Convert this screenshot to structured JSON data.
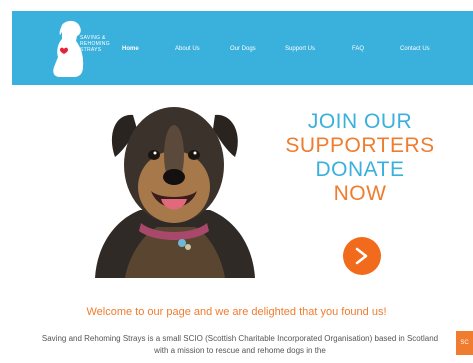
{
  "header": {
    "logo_lines": [
      "Saving &",
      "Rehoming",
      "Strays"
    ],
    "nav": [
      {
        "label": "Home",
        "active": true
      },
      {
        "label": "About Us",
        "active": false
      },
      {
        "label": "Our Dogs",
        "active": false
      },
      {
        "label": "Support Us",
        "active": false
      },
      {
        "label": "FAQ",
        "active": false
      },
      {
        "label": "Contact Us",
        "active": false
      }
    ]
  },
  "promo": {
    "line1": "JOIN OUR",
    "line2": "SUPPORTERS",
    "line3": "DONATE",
    "line4": "NOW",
    "button_glyph": ">"
  },
  "welcome": "Welcome to our page and we are delighted that you found us!",
  "intro": "Saving and Rehoming Strays is a small SCIO (Scottish Charitable Incorporated Organisation) based in Scotland with a mission to rescue and rehome dogs in the",
  "side_tab": "SC",
  "colors": {
    "header_bg": "#3ab0dc",
    "accent_orange": "#f07c2f",
    "button_orange": "#f26a1b",
    "text_blue": "#3ab0dc"
  }
}
